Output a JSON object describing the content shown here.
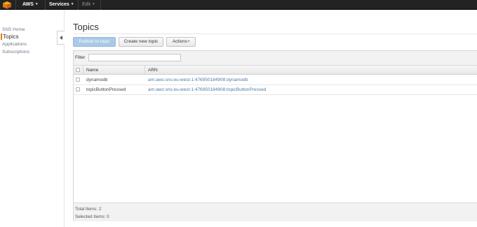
{
  "topbar": {
    "logo_icon": "aws-cube-icon",
    "aws_label": "AWS",
    "services_label": "Services",
    "edit_label": "Edit",
    "caret": "▾"
  },
  "sidebar": {
    "items": [
      {
        "label": "SNS Home",
        "active": false
      },
      {
        "label": "Topics",
        "active": true
      },
      {
        "label": "Applications",
        "active": false
      },
      {
        "label": "Subscriptions",
        "active": false
      }
    ]
  },
  "main": {
    "title": "Topics",
    "buttons": {
      "publish": "Publish to topic",
      "create": "Create new topic",
      "actions": "Actions"
    },
    "filter": {
      "label": "Filter",
      "value": ""
    },
    "table": {
      "columns": [
        "Name",
        "ARN"
      ],
      "rows": [
        {
          "name": "dynamodb",
          "arn": "arn:aws:sns:eu-west-1:476950184908:dynamodb"
        },
        {
          "name": "topicButtonPressed",
          "arn": "arn:aws:sns:eu-west-1:476950184908:topicButtonPressed"
        }
      ]
    },
    "footer": {
      "total": "Total Items: 2",
      "selected": "Selected Items: 0"
    }
  },
  "colors": {
    "accent": "#e47911",
    "link": "#4f7aa8",
    "primary_button": "#a8c9e7",
    "topbar": "#232323"
  }
}
